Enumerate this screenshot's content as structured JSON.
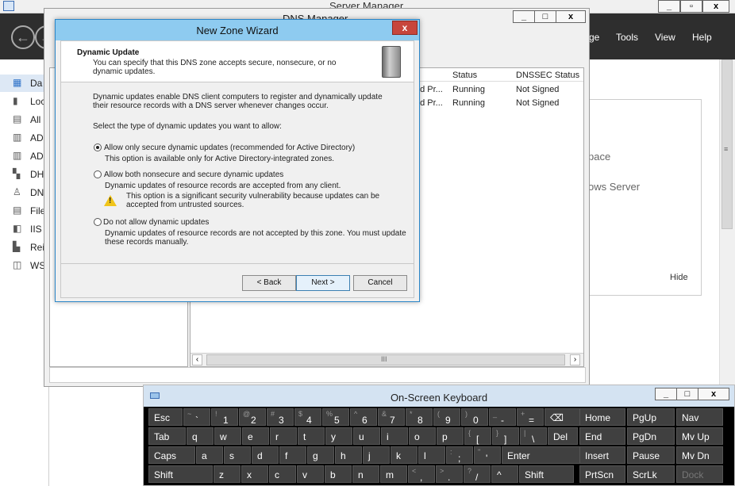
{
  "server_manager": {
    "title": "Server Manager",
    "menu": [
      "ge",
      "Tools",
      "View",
      "Help"
    ],
    "nav": [
      {
        "label": "Da",
        "icon": "dashboard-icon"
      },
      {
        "label": "Loc",
        "icon": "local-server-icon"
      },
      {
        "label": "All",
        "icon": "all-servers-icon"
      },
      {
        "label": "AD",
        "icon": "ad-cs-icon"
      },
      {
        "label": "AD",
        "icon": "ad-ds-icon"
      },
      {
        "label": "DH",
        "icon": "dhcp-icon"
      },
      {
        "label": "DN",
        "icon": "dns-icon"
      },
      {
        "label": "File",
        "icon": "file-services-icon"
      },
      {
        "label": "IIS",
        "icon": "iis-icon"
      },
      {
        "label": "Rei",
        "icon": "remote-access-icon"
      },
      {
        "label": "WS",
        "icon": "wsus-icon"
      }
    ],
    "right_panel": {
      "line1": "pace",
      "line2": "ows Server",
      "hide": "Hide"
    }
  },
  "dns_manager": {
    "title": "DNS Manager",
    "columns": [
      "Status",
      "DNSSEC Status"
    ],
    "rows": [
      {
        "type": "ed Pr...",
        "status": "Running",
        "dnssec": "Not Signed"
      },
      {
        "type": "ed Pr...",
        "status": "Running",
        "dnssec": "Not Signed"
      }
    ],
    "scroll_mid": "III"
  },
  "wizard": {
    "title": "New Zone Wizard",
    "header_title": "Dynamic Update",
    "header_desc": "You can specify that this DNS zone accepts secure, nonsecure, or no dynamic updates.",
    "intro": "Dynamic updates enable DNS client computers to register and dynamically update their resource records with a DNS server whenever changes occur.",
    "prompt": "Select the type of dynamic updates you want to allow:",
    "options": [
      {
        "label": "Allow only secure dynamic updates (recommended for Active Directory)",
        "desc": "This option is available only for Active Directory-integrated zones.",
        "selected": true
      },
      {
        "label": "Allow both nonsecure and secure dynamic updates",
        "desc": "Dynamic updates of resource records are accepted from any client.",
        "warning": "This option is a significant security vulnerability because updates can be accepted from untrusted sources.",
        "selected": false
      },
      {
        "label": "Do not allow dynamic updates",
        "desc": "Dynamic updates of resource records are not accepted by this zone. You must update these records manually.",
        "selected": false
      }
    ],
    "buttons": {
      "back": "< Back",
      "next": "Next >",
      "cancel": "Cancel"
    },
    "close": "x"
  },
  "osk": {
    "title": "On-Screen Keyboard",
    "rows": [
      [
        {
          "m": "Esc"
        },
        {
          "s": "~",
          "b": "`"
        },
        {
          "s": "!",
          "b": "1"
        },
        {
          "s": "@",
          "b": "2"
        },
        {
          "s": "#",
          "b": "3"
        },
        {
          "s": "$",
          "b": "4"
        },
        {
          "s": "%",
          "b": "5"
        },
        {
          "s": "^",
          "b": "6"
        },
        {
          "s": "&",
          "b": "7"
        },
        {
          "s": "*",
          "b": "8"
        },
        {
          "s": "(",
          "b": "9"
        },
        {
          "s": ")",
          "b": "0"
        },
        {
          "s": "_",
          "b": "-"
        },
        {
          "s": "+",
          "b": "="
        },
        {
          "m": "⌫"
        }
      ],
      [
        {
          "m": "Tab"
        },
        {
          "m": "q"
        },
        {
          "m": "w"
        },
        {
          "m": "e"
        },
        {
          "m": "r"
        },
        {
          "m": "t"
        },
        {
          "m": "y"
        },
        {
          "m": "u"
        },
        {
          "m": "i"
        },
        {
          "m": "o"
        },
        {
          "m": "p"
        },
        {
          "s": "{",
          "b": "["
        },
        {
          "s": "}",
          "b": "]"
        },
        {
          "s": "|",
          "b": "\\"
        },
        {
          "m": "Del"
        }
      ],
      [
        {
          "m": "Caps"
        },
        {
          "m": "a"
        },
        {
          "m": "s"
        },
        {
          "m": "d"
        },
        {
          "m": "f"
        },
        {
          "m": "g"
        },
        {
          "m": "h"
        },
        {
          "m": "j"
        },
        {
          "m": "k"
        },
        {
          "m": "l"
        },
        {
          "s": ":",
          "b": ";"
        },
        {
          "s": "\"",
          "b": "'"
        },
        {
          "m": "Enter"
        }
      ],
      [
        {
          "m": "Shift"
        },
        {
          "m": "z"
        },
        {
          "m": "x"
        },
        {
          "m": "c"
        },
        {
          "m": "v"
        },
        {
          "m": "b"
        },
        {
          "m": "n"
        },
        {
          "m": "m"
        },
        {
          "s": "<",
          "b": ","
        },
        {
          "s": ">",
          "b": "."
        },
        {
          "s": "?",
          "b": "/"
        },
        {
          "m": "^"
        },
        {
          "m": "Shift"
        }
      ]
    ],
    "side": [
      [
        {
          "m": "Home"
        },
        {
          "m": "PgUp"
        },
        {
          "m": "Nav"
        }
      ],
      [
        {
          "m": "End"
        },
        {
          "m": "PgDn"
        },
        {
          "m": "Mv Up"
        }
      ],
      [
        {
          "m": "Insert"
        },
        {
          "m": "Pause"
        },
        {
          "m": "Mv Dn"
        }
      ],
      [
        {
          "m": "PrtScn"
        },
        {
          "m": "ScrLk"
        },
        {
          "m": "Dock",
          "disabled": true
        }
      ]
    ]
  }
}
